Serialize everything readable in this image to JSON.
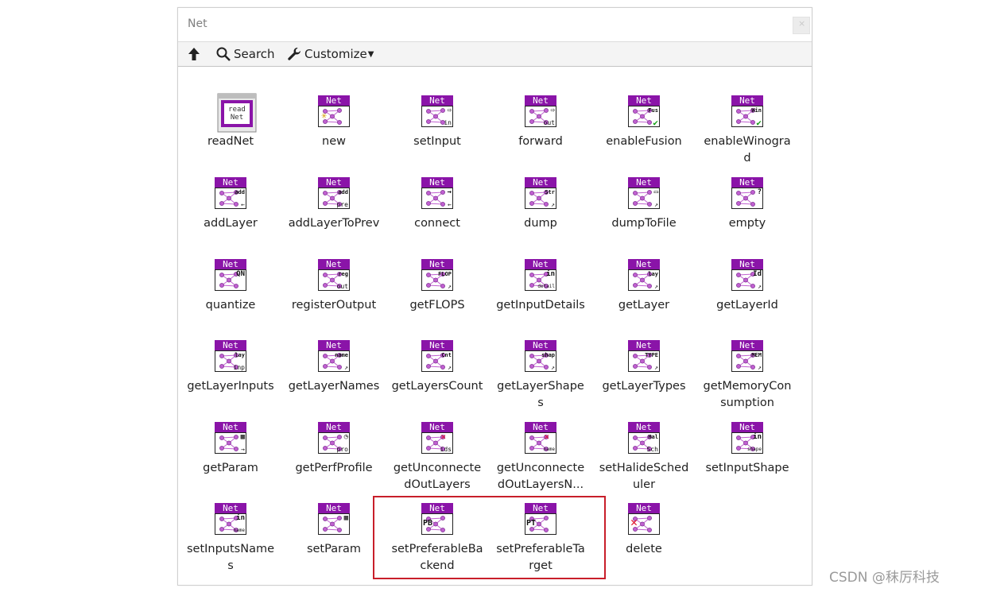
{
  "window": {
    "title": "Net"
  },
  "toolbar": {
    "search_label": "Search",
    "customize_label": "Customize"
  },
  "items": [
    {
      "name": "readnet",
      "label": "readNet",
      "glyph": "",
      "glyph2": ""
    },
    {
      "name": "new",
      "label": "new",
      "glyph": "✳",
      "glyph2": ""
    },
    {
      "name": "setinput",
      "label": "setInput",
      "glyph": "⇨",
      "glyph2": "in"
    },
    {
      "name": "forward",
      "label": "forward",
      "glyph": "⇨",
      "glyph2": "out"
    },
    {
      "name": "enablefusion",
      "label": "enableFusion",
      "glyph": "Fus",
      "glyph2": "✔"
    },
    {
      "name": "enablewinograd",
      "label": "enableWinograd",
      "glyph": "Win",
      "glyph2": "✔"
    },
    {
      "name": "addlayer",
      "label": "addLayer",
      "glyph": "add",
      "glyph2": "←"
    },
    {
      "name": "addlayertoprev",
      "label": "addLayerToPrev",
      "glyph": "add",
      "glyph2": "pre"
    },
    {
      "name": "connect",
      "label": "connect",
      "glyph": "→",
      "glyph2": "←"
    },
    {
      "name": "dump",
      "label": "dump",
      "glyph": "Str",
      "glyph2": "↗"
    },
    {
      "name": "dumptofile",
      "label": "dumpToFile",
      "glyph": "▭",
      "glyph2": "↗"
    },
    {
      "name": "empty",
      "label": "empty",
      "glyph": "?",
      "glyph2": ""
    },
    {
      "name": "quantize",
      "label": "quantize",
      "glyph": "QN",
      "glyph2": ""
    },
    {
      "name": "registeroutput",
      "label": "registerOutput",
      "glyph": "reg",
      "glyph2": "out"
    },
    {
      "name": "getflops",
      "label": "getFLOPS",
      "glyph": "FLOP",
      "glyph2": "↗"
    },
    {
      "name": "getinputdetails",
      "label": "getInputDetails",
      "glyph": "in",
      "glyph2": "detail"
    },
    {
      "name": "getlayer",
      "label": "getLayer",
      "glyph": "lay",
      "glyph2": "↗"
    },
    {
      "name": "getlayerid",
      "label": "getLayerId",
      "glyph": "Id",
      "glyph2": "↗"
    },
    {
      "name": "getlayerinputs",
      "label": "getLayerInputs",
      "glyph": "lay",
      "glyph2": "inp"
    },
    {
      "name": "getlayernames",
      "label": "getLayerNames",
      "glyph": "name",
      "glyph2": "↗"
    },
    {
      "name": "getlayerscount",
      "label": "getLayersCount",
      "glyph": "Cnt",
      "glyph2": "↗"
    },
    {
      "name": "getlayershapes",
      "label": "getLayerShapes",
      "glyph": "shap",
      "glyph2": "↗"
    },
    {
      "name": "getlayertypes",
      "label": "getLayerTypes",
      "glyph": "TYPE",
      "glyph2": "↗"
    },
    {
      "name": "getmemoryconsumption",
      "label": "getMemoryConsumption",
      "glyph": "MEM",
      "glyph2": "↗"
    },
    {
      "name": "getparam",
      "label": "getParam",
      "glyph": "▦",
      "glyph2": "→"
    },
    {
      "name": "getperfprofile",
      "label": "getPerfProfile",
      "glyph": "◷",
      "glyph2": "pro"
    },
    {
      "name": "getunconnectedoutlayers",
      "label": "getUnconnectedOutLayers",
      "glyph": "✕",
      "glyph2": "ids"
    },
    {
      "name": "getunconnectedoutlayersnames",
      "label": "getUnconnectedOutLayersN...",
      "glyph": "✕",
      "glyph2": "name"
    },
    {
      "name": "sethalidescheduler",
      "label": "setHalideScheduler",
      "glyph": "Hal",
      "glyph2": "Sch"
    },
    {
      "name": "setinputshape",
      "label": "setInputShape",
      "glyph": "in",
      "glyph2": "shape"
    },
    {
      "name": "setinputsnames",
      "label": "setInputsNames",
      "glyph": "in",
      "glyph2": "name"
    },
    {
      "name": "setparam",
      "label": "setParam",
      "glyph": "▦",
      "glyph2": ""
    },
    {
      "name": "setpreferablebackend",
      "label": "setPreferableBackend",
      "glyph": "PB",
      "glyph2": ""
    },
    {
      "name": "setpreferabletarget",
      "label": "setPreferableTarget",
      "glyph": "PT",
      "glyph2": ""
    },
    {
      "name": "delete",
      "label": "delete",
      "glyph": "✕",
      "glyph2": ""
    }
  ],
  "icon_header_text": "Net",
  "readnet_icon_text": [
    "read",
    "Net"
  ],
  "colors": {
    "accent": "#8a14a8",
    "highlight": "#c81e2a",
    "node": "#c060d0"
  },
  "watermark": "CSDN @秣厉科技"
}
